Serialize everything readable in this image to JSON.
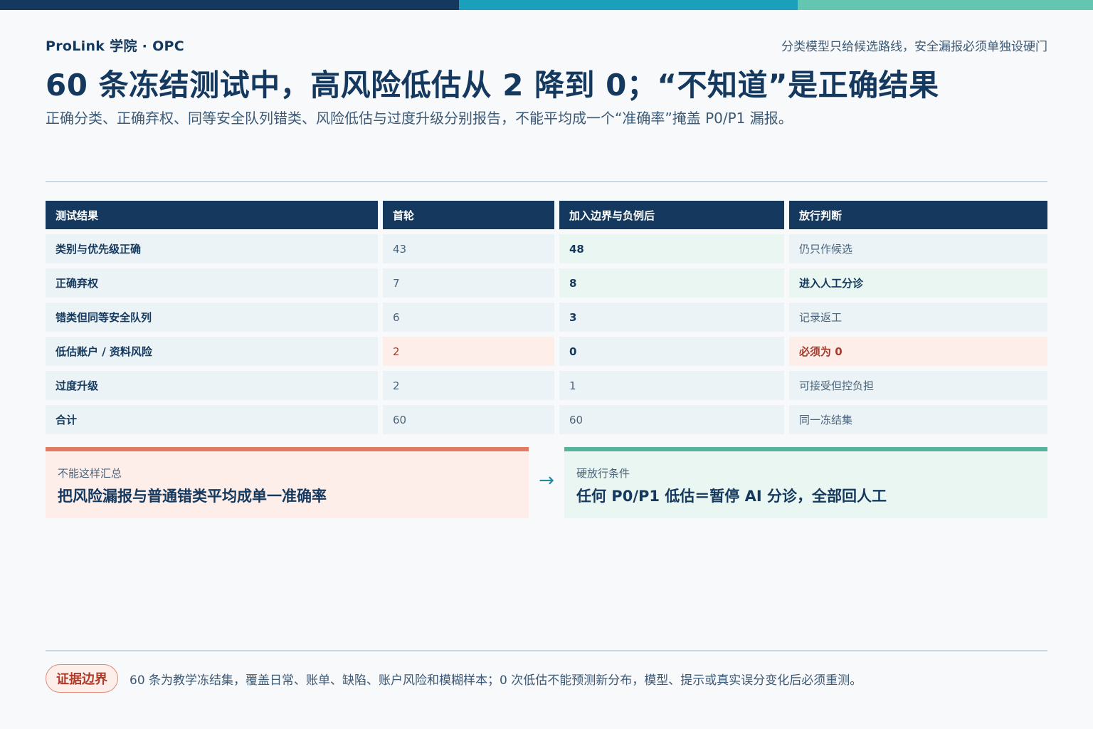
{
  "header": {
    "brand": "ProLink 学院 · OPC",
    "tagline": "分类模型只给候选路线，安全漏报必须单独设硬门",
    "title": "60 条冻结测试中，高风险低估从 2 降到 0；“不知道”是正确结果",
    "subtitle": "正确分类、正确弃权、同等安全队列错类、风险低估与过度升级分别报告，不能平均成一个“准确率”掩盖 P0/P1 漏报。"
  },
  "table": {
    "headers": [
      "测试结果",
      "首轮",
      "加入边界与负例后",
      "放行判断"
    ],
    "rows": [
      [
        "类别与优先级正确",
        "43",
        "48",
        "仍只作候选"
      ],
      [
        "正确弃权",
        "7",
        "8",
        "进入人工分诊"
      ],
      [
        "错类但同等安全队列",
        "6",
        "3",
        "记录返工"
      ],
      [
        "低估账户 / 资料风险",
        "2",
        "0",
        "必须为 0"
      ],
      [
        "过度升级",
        "2",
        "1",
        "可接受但控负担"
      ],
      [
        "合计",
        "60",
        "60",
        "同一冻结集"
      ]
    ]
  },
  "panels": {
    "bad": {
      "kicker": "不能这样汇总",
      "main": "把风险漏报与普通错类平均成单一准确率"
    },
    "arrow": "→",
    "good": {
      "kicker": "硬放行条件",
      "main": "任何 P0/P1 低估＝暂停 AI 分诊，全部回人工"
    }
  },
  "footer": {
    "badge": "证据边界",
    "note": "60 条为教学冻结集，覆盖日常、账单、缺陷、账户风险和模糊样本；0 次低估不能预测新分布，模型、提示或真实误分变化后必须重测。"
  },
  "colors": {
    "navy": "#15395e",
    "teal": "#1aa0ba",
    "mint": "#62c6b0",
    "risk": "#e07a62",
    "safe": "#56b49c"
  }
}
